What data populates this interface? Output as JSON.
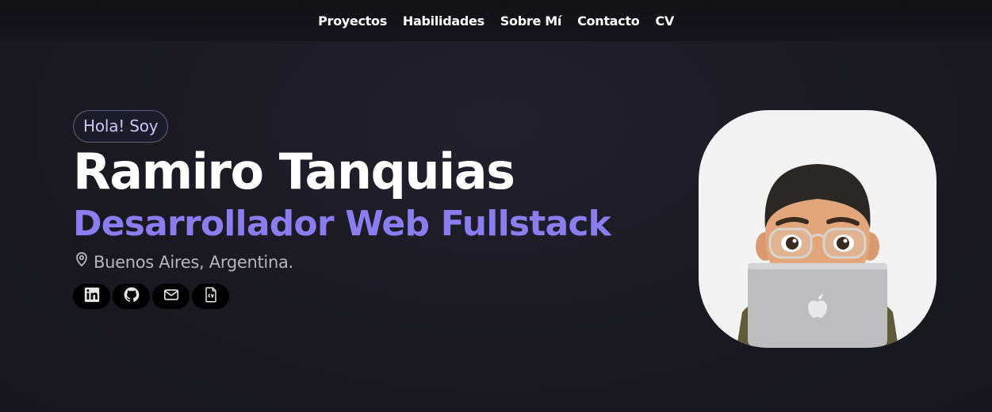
{
  "nav": {
    "links": [
      "Proyectos",
      "Habilidades",
      "Sobre Mí",
      "Contacto",
      "CV"
    ]
  },
  "hero": {
    "greeting": "Hola! Soy",
    "name": "Ramiro Tanquias",
    "role": "Desarrollador Web Fullstack",
    "location": "Buenos Aires, Argentina."
  },
  "socials": [
    {
      "icon": "linkedin-icon"
    },
    {
      "icon": "github-icon"
    },
    {
      "icon": "mail-icon"
    },
    {
      "icon": "cv-icon"
    }
  ],
  "colors": {
    "accent": "#8a7df0",
    "background": "#1a1921",
    "badge_text": "#c9c8f4"
  }
}
